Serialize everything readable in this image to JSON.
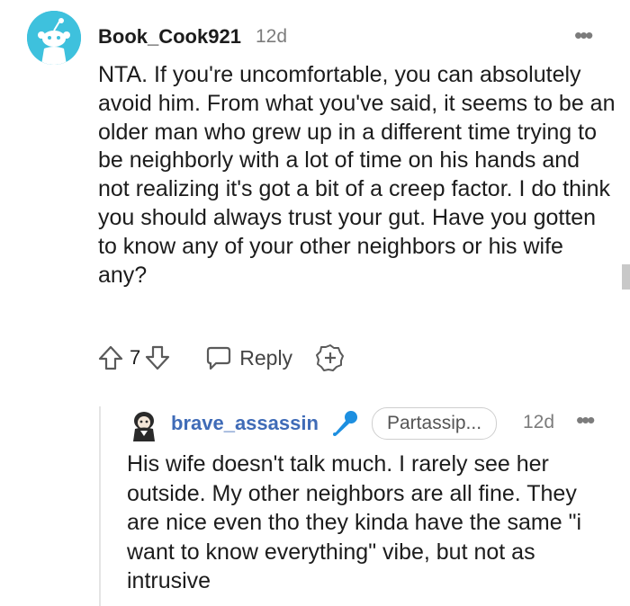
{
  "comment": {
    "username": "Book_Cook921",
    "time": "12d",
    "more_icon": "•••",
    "body": "NTA. If you're uncomfortable, you can absolutely avoid him. From what you've said, it seems to be an older man who grew up in a different time trying to be neighborly with a lot of time on his hands and not realizing it's got a bit of a creep factor. I do think you should always trust your gut. Have you gotten to know any of your other neighbors or his wife any?",
    "score": "7",
    "reply_label": "Reply",
    "icons": {
      "avatar": "snoo-avatar-icon",
      "upvote": "upvote-arrow-icon",
      "downvote": "downvote-arrow-icon",
      "reply": "chat-bubble-icon",
      "award": "award-plus-icon"
    }
  },
  "reply": {
    "username": "brave_assassin",
    "flair": "Partassip...",
    "time": "12d",
    "more_icon": "•••",
    "body": "His wife doesn't talk much. I rarely see her outside. My other neighbors are all fine. They are nice even tho they kinda have the same \"i want to know everything\" vibe, but not as intrusive",
    "icons": {
      "avatar": "user-avatar-icon",
      "badge": "microphone-icon"
    }
  },
  "colors": {
    "avatar_bg": "#3ec1dd",
    "username_reply": "#3f6bb7",
    "meta_gray": "#7c7c7c",
    "thread_line": "#e4e4e4"
  }
}
